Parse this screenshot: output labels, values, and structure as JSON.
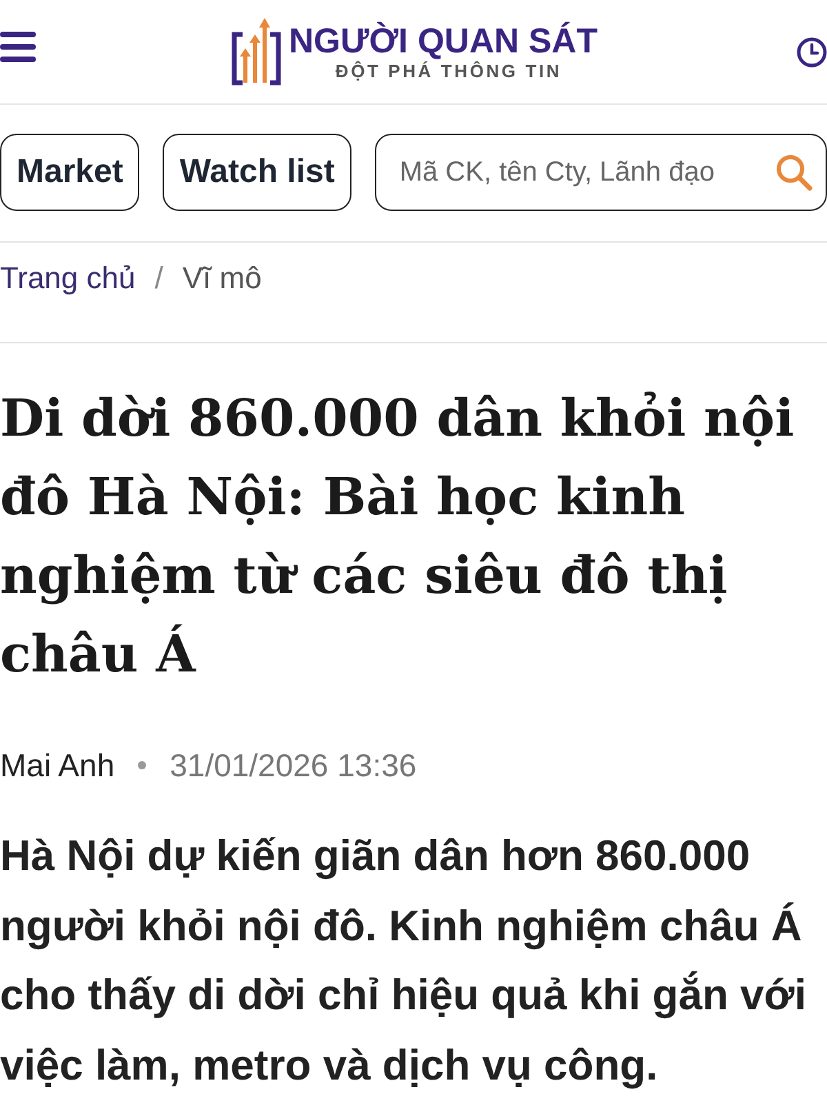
{
  "header": {
    "logo": {
      "title": "NGƯỜI QUAN SÁT",
      "tagline": "ĐỘT PHÁ THÔNG TIN"
    }
  },
  "nav": {
    "buttons": [
      "Market",
      "Watch list"
    ],
    "search": {
      "placeholder": "Mã CK, tên Cty, Lãnh đạo"
    }
  },
  "breadcrumb": {
    "items": [
      {
        "label": "Trang chủ",
        "kind": "link"
      },
      {
        "label": "Vĩ mô",
        "kind": "current"
      }
    ],
    "separator": "/"
  },
  "article": {
    "title": "Di dời 860.000 dân khỏi nội đô Hà Nội: Bài học kinh nghiệm từ các siêu đô thị châu Á",
    "author": "Mai Anh",
    "date": "31/01/2026 13:36",
    "lead": "Hà Nội dự kiến giãn dân hơn 860.000 người khỏi nội đô. Kinh nghiệm châu Á cho thấy di dời chỉ hiệu quả khi gắn với việc làm, metro và dịch vụ công."
  }
}
